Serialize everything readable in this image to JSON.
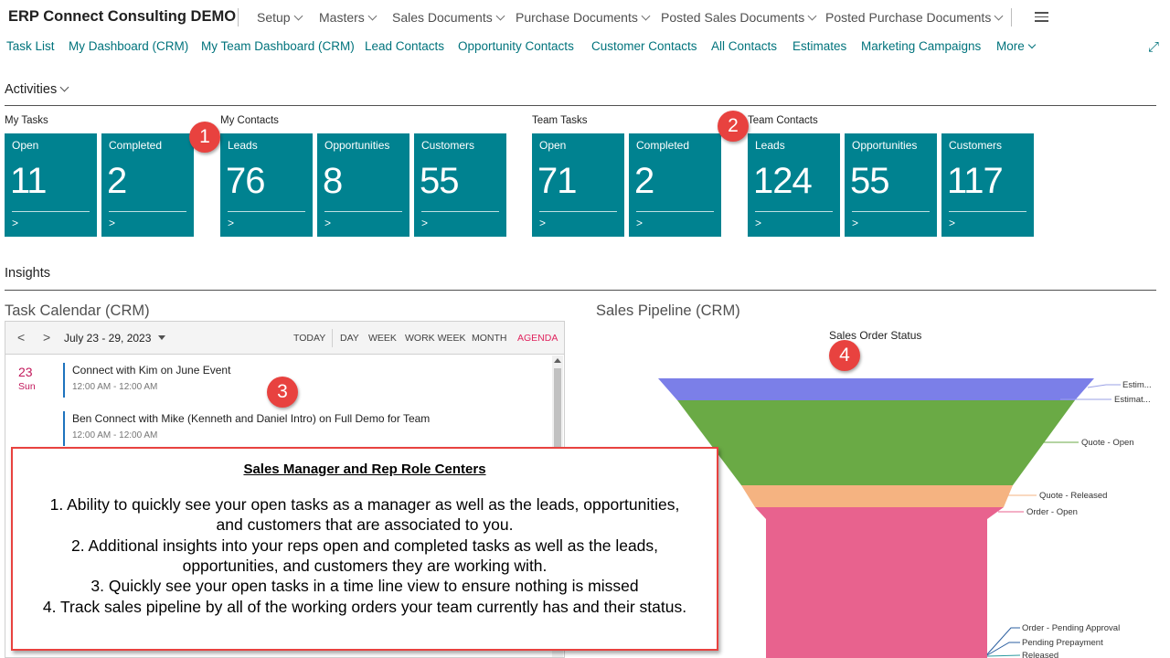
{
  "app": {
    "title": "ERP Connect Consulting DEMO"
  },
  "menu": [
    {
      "label": "Setup"
    },
    {
      "label": "Masters"
    },
    {
      "label": "Sales Documents"
    },
    {
      "label": "Purchase Documents"
    },
    {
      "label": "Posted Sales Documents"
    },
    {
      "label": "Posted Purchase Documents"
    }
  ],
  "nav": [
    {
      "label": "Task List"
    },
    {
      "label": "My Dashboard (CRM)"
    },
    {
      "label": "My Team Dashboard (CRM)"
    },
    {
      "label": "Lead Contacts"
    },
    {
      "label": "Opportunity Contacts"
    },
    {
      "label": "Customer Contacts"
    },
    {
      "label": "All Contacts"
    },
    {
      "label": "Estimates"
    },
    {
      "label": "Marketing Campaigns"
    },
    {
      "label": "More"
    }
  ],
  "activities": {
    "title": "Activities",
    "groups": [
      {
        "label": "My Tasks"
      },
      {
        "label": "My Contacts"
      },
      {
        "label": "Team Tasks"
      },
      {
        "label": "Team Contacts"
      }
    ],
    "tiles": [
      {
        "label": "Open",
        "value": "11",
        "arrow": ">"
      },
      {
        "label": "Completed",
        "value": "2",
        "arrow": ">"
      },
      {
        "label": "Leads",
        "value": "76",
        "arrow": ">"
      },
      {
        "label": "Opportunities",
        "value": "8",
        "arrow": ">"
      },
      {
        "label": "Customers",
        "value": "55",
        "arrow": ">"
      },
      {
        "label": "Open",
        "value": "71",
        "arrow": ">"
      },
      {
        "label": "Completed",
        "value": "2",
        "arrow": ">"
      },
      {
        "label": "Leads",
        "value": "124",
        "arrow": ">"
      },
      {
        "label": "Opportunities",
        "value": "55",
        "arrow": ">"
      },
      {
        "label": "Customers",
        "value": "117",
        "arrow": ">"
      }
    ]
  },
  "insights": {
    "title": "Insights"
  },
  "calendar": {
    "title": "Task Calendar (CRM)",
    "range": "July 23 - 29, 2023",
    "prev": "<",
    "next": ">",
    "views": [
      {
        "label": "TODAY"
      },
      {
        "label": "DAY"
      },
      {
        "label": "WEEK"
      },
      {
        "label": "WORK WEEK"
      },
      {
        "label": "MONTH"
      },
      {
        "label": "AGENDA",
        "active": true
      }
    ],
    "day_num": "23",
    "day_name": "Sun",
    "events": [
      {
        "title": "Connect with Kim on June Event",
        "time": "12:00 AM - 12:00 AM"
      },
      {
        "title": "Ben Connect with Mike (Kenneth and Daniel Intro) on Full Demo for Team",
        "time": "12:00 AM - 12:00 AM"
      }
    ]
  },
  "pipeline": {
    "title": "Sales Pipeline (CRM)",
    "chart_title": "Sales Order Status",
    "labels": [
      {
        "text": "Estim..."
      },
      {
        "text": "Estimat..."
      },
      {
        "text": "Quote - Open"
      },
      {
        "text": "Quote - Released"
      },
      {
        "text": "Order - Open"
      },
      {
        "text": "Order - Pending Approval"
      },
      {
        "text": "Pending Prepayment"
      },
      {
        "text": "Released"
      }
    ],
    "colors": [
      "#7b7fe8",
      "#6aaa45",
      "#f5b381",
      "#e8628e"
    ]
  },
  "badges": [
    "1",
    "2",
    "3",
    "4"
  ],
  "callout": {
    "title": "Sales Manager and Rep Role Centers",
    "items": [
      "1. Ability to quickly see your open tasks as a manager as well as the leads, opportunities, and customers that are associated to you.",
      "2. Additional insights into your reps open and completed tasks as well as the leads, opportunities, and customers they are working with.",
      "3. Quickly see your open tasks in a time line view to ensure nothing is missed",
      "4. Track sales pipeline by all of the working orders your team currently has and their status."
    ]
  },
  "chart_data": {
    "type": "funnel",
    "title": "Sales Order Status",
    "categories": [
      "Estim...",
      "Estimat...",
      "Quote - Open",
      "Quote - Released",
      "Order - Open",
      "Order - Pending Approval",
      "Pending Prepayment",
      "Released"
    ]
  }
}
